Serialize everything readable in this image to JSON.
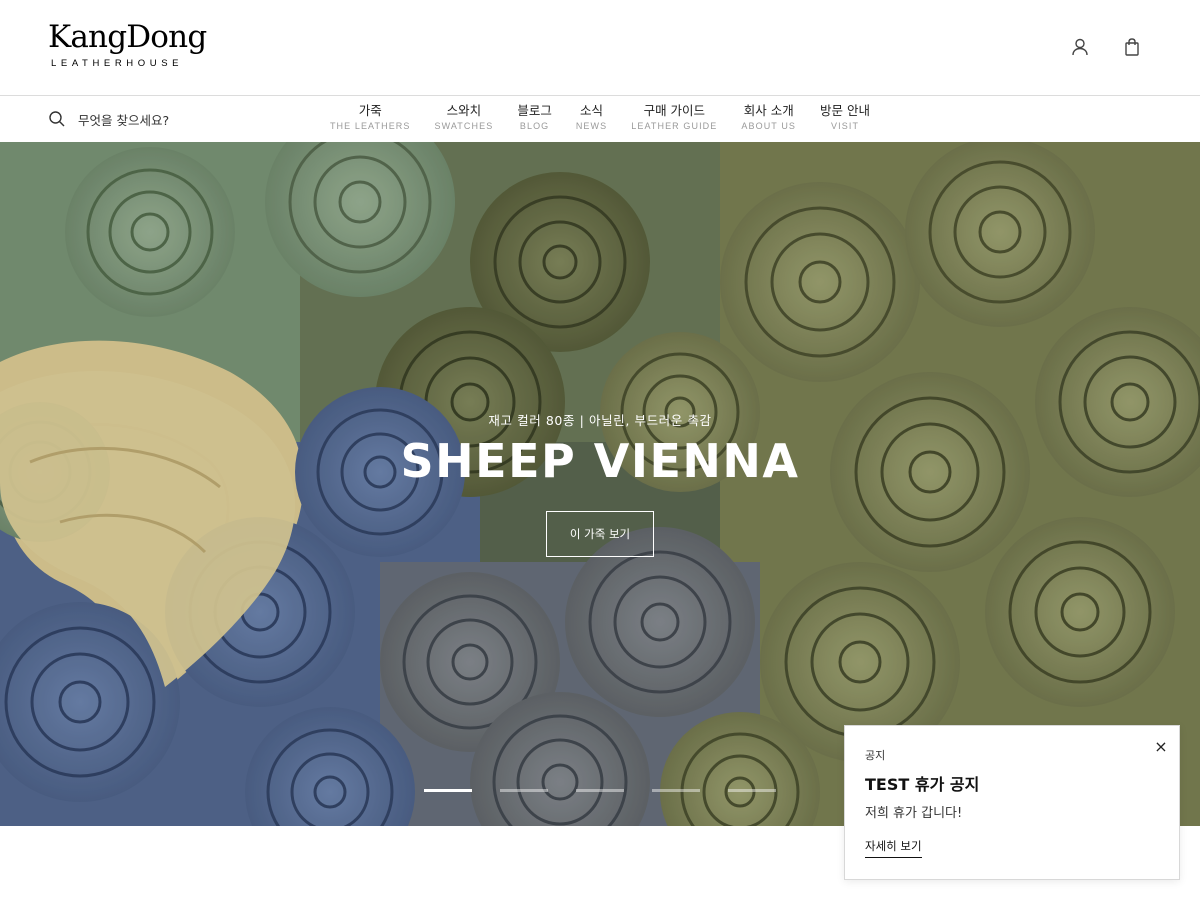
{
  "logo": {
    "main": "KangDong",
    "sub": "LEATHERHOUSE"
  },
  "header": {
    "icons": [
      "user-icon",
      "shopping-bag-icon"
    ]
  },
  "search": {
    "placeholder": "무엇을 찾으세요?"
  },
  "nav": [
    {
      "ko": "가죽",
      "en": "THE LEATHERS"
    },
    {
      "ko": "스와치",
      "en": "SWATCHES"
    },
    {
      "ko": "블로그",
      "en": "BLOG"
    },
    {
      "ko": "소식",
      "en": "NEWS"
    },
    {
      "ko": "구매 가이드",
      "en": "LEATHER GUIDE"
    },
    {
      "ko": "회사 소개",
      "en": "ABOUT US"
    },
    {
      "ko": "방문 안내",
      "en": "VISIT"
    }
  ],
  "hero": {
    "subtitle": "재고 컬러 80종 | 아닐린, 부드러운 촉감",
    "title": "SHEEP VIENNA",
    "button": "이 가죽 보기",
    "slides": 5,
    "active_slide": 1
  },
  "notice": {
    "label": "공지",
    "title": "TEST 휴가 공지",
    "body": "저희 휴가 갑니다!",
    "link": "자세히 보기",
    "close": "×"
  },
  "colors": {
    "sage": "#8ea88a",
    "olive": "#8f9460",
    "blue": "#5c77a8",
    "cream": "#e9d9a0"
  }
}
